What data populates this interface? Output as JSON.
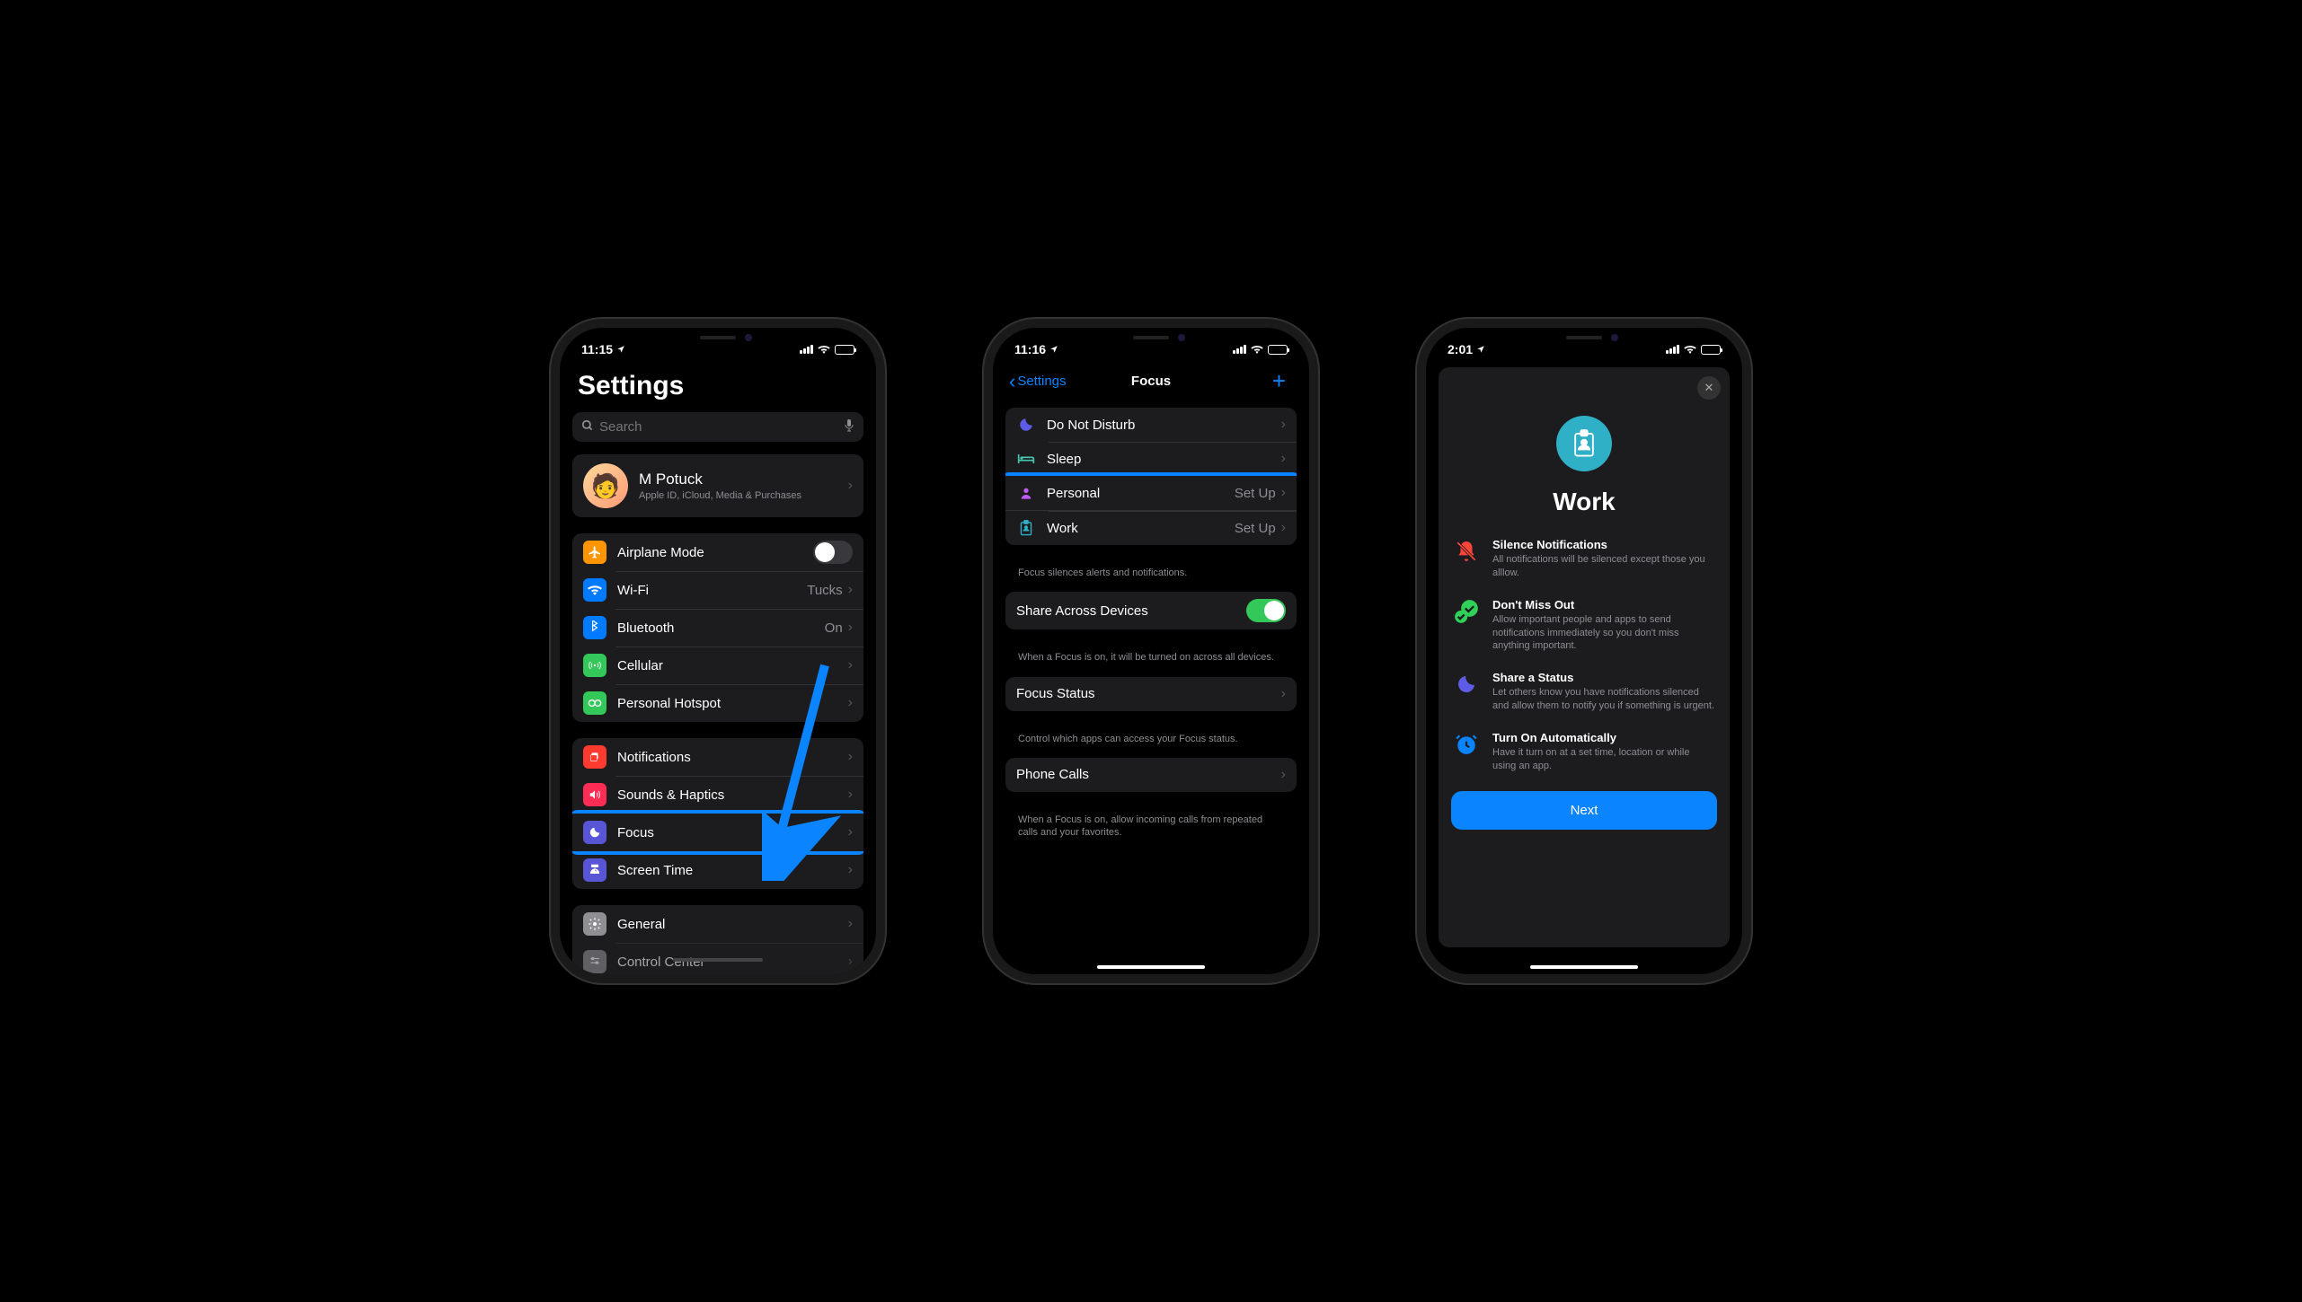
{
  "phone1": {
    "time": "11:15",
    "title": "Settings",
    "search_placeholder": "Search",
    "profile": {
      "name": "M Potuck",
      "sub": "Apple ID, iCloud, Media & Purchases"
    },
    "airplane": "Airplane Mode",
    "wifi": {
      "label": "Wi-Fi",
      "value": "Tucks"
    },
    "bluetooth": {
      "label": "Bluetooth",
      "value": "On"
    },
    "cellular": "Cellular",
    "hotspot": "Personal Hotspot",
    "notifications": "Notifications",
    "sounds": "Sounds & Haptics",
    "focus": "Focus",
    "screentime": "Screen Time",
    "general": "General",
    "control_center": "Control Center"
  },
  "phone2": {
    "time": "11:16",
    "back": "Settings",
    "title": "Focus",
    "items": {
      "dnd": "Do Not Disturb",
      "sleep": "Sleep",
      "personal": {
        "label": "Personal",
        "action": "Set Up"
      },
      "work": {
        "label": "Work",
        "action": "Set Up"
      }
    },
    "focus_footer": "Focus silences alerts and notifications.",
    "share": "Share Across Devices",
    "share_footer": "When a Focus is on, it will be turned on across all devices.",
    "status": "Focus Status",
    "status_footer": "Control which apps can access your Focus status.",
    "calls": "Phone Calls",
    "calls_footer": "When a Focus is on, allow incoming calls from repeated calls and your favorites."
  },
  "phone3": {
    "time": "2:01",
    "title": "Work",
    "features": [
      {
        "title": "Silence Notifications",
        "desc": "All notifications will be silenced except those you alllow."
      },
      {
        "title": "Don't Miss Out",
        "desc": "Allow important people and apps to send notifications immediately so you don't miss anything important."
      },
      {
        "title": "Share a Status",
        "desc": "Let others know you have notifications silenced and allow them to notify you if something is urgent."
      },
      {
        "title": "Turn On Automatically",
        "desc": "Have it turn on at a set time, location or while using an app."
      }
    ],
    "next": "Next"
  }
}
